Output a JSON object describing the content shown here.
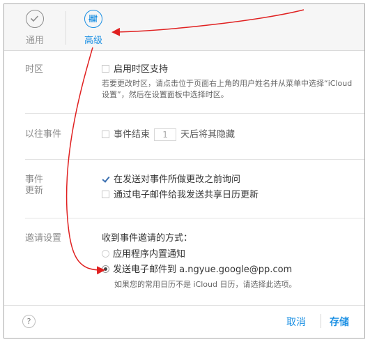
{
  "toolbar": {
    "tabs": [
      {
        "label": "通用",
        "icon": "checkmark-circle-icon",
        "active": false
      },
      {
        "label": "高级",
        "icon": "equalizer-sliders-icon",
        "active": true
      }
    ]
  },
  "timezone": {
    "label": "时区",
    "checkbox_label": "启用时区支持",
    "hint_line1": "若要更改时区，请点击位于页面右上角的用户姓名并从菜单中选择“iCloud",
    "hint_line2": "设置”，然后在设置面板中选择时区。"
  },
  "past_events": {
    "label": "以往事件",
    "checkbox_label": "事件结束",
    "days_value": "1",
    "suffix": "天后将其隐藏"
  },
  "events": {
    "label_line1": "事件",
    "label_line2": "更新",
    "option1": "在发送对事件所做更改之前询问",
    "option2": "通过电子邮件给我发送共享日历更新"
  },
  "invitations": {
    "label": "邀请设置",
    "prompt": "收到事件邀请的方式：",
    "option1": "应用程序内置通知",
    "option2": "发送电子邮件到 a.ngyue.google@pp.com",
    "hint": "如果您的常用日历不是 iCloud 日历，请选择此选项。"
  },
  "footer": {
    "help": "?",
    "cancel": "取消",
    "save": "存储"
  },
  "colors": {
    "accent": "#1a8fe3",
    "annotation_arrow": "#e02020"
  }
}
